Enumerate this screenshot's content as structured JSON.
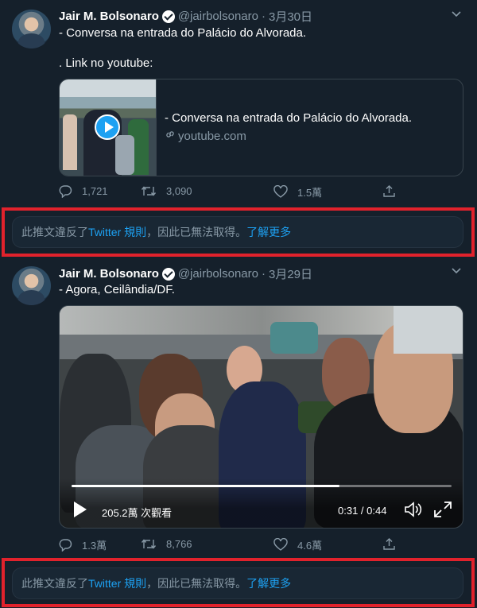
{
  "tweets": [
    {
      "name": "Jair M. Bolsonaro",
      "handle": "@jairbolsonaro",
      "separator": "·",
      "date": "3月30日",
      "text_line1": "- Conversa na entrada do Palácio do Alvorada.",
      "text_line2": ". Link no youtube:",
      "card": {
        "title": "- Conversa na entrada do Palácio do Alvorada.",
        "domain": "youtube.com"
      },
      "actions": {
        "replies": "1,721",
        "retweets": "3,090",
        "likes": "1.5萬"
      }
    },
    {
      "name": "Jair M. Bolsonaro",
      "handle": "@jairbolsonaro",
      "separator": "·",
      "date": "3月29日",
      "text_line1": "- Agora, Ceilândia/DF.",
      "video": {
        "views": "205.2萬 次觀看",
        "time": "0:31 / 0:44",
        "progress": 0.705
      },
      "actions": {
        "replies": "1.3萬",
        "retweets": "8,766",
        "likes": "4.6萬"
      }
    }
  ],
  "notice": {
    "prefix": "此推文違反了 ",
    "rules_link": "Twitter 規則",
    "suffix": "，因此已無法取得。",
    "learn_more": "了解更多"
  },
  "colors": {
    "background": "#15202b",
    "accent": "#1da1f2",
    "muted": "#8899a6",
    "highlight_border": "#e1222c"
  }
}
